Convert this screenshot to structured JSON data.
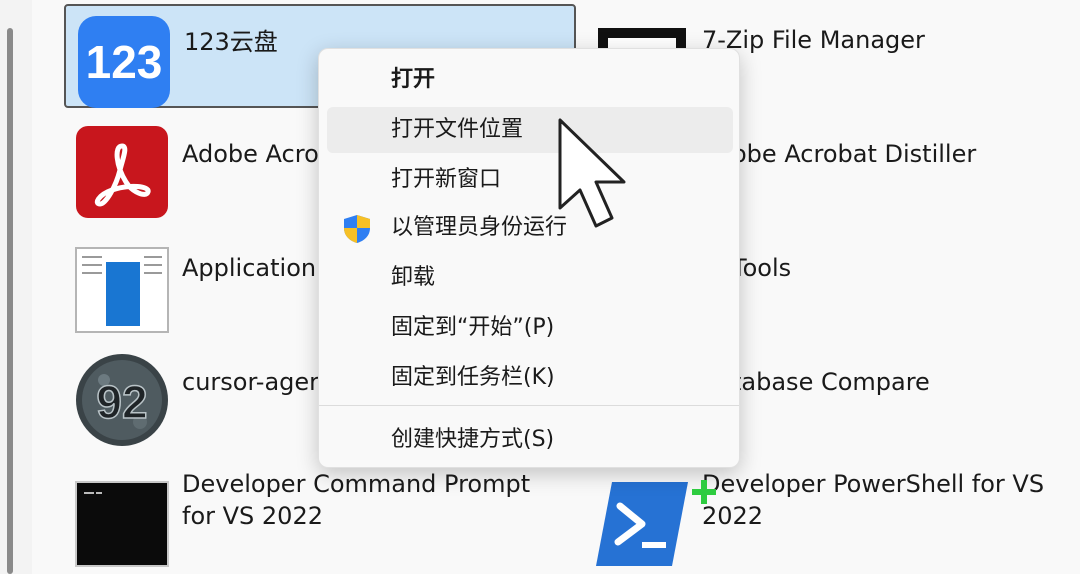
{
  "apps": [
    {
      "name": "123云盘"
    },
    {
      "name": "7-Zip File Manager"
    },
    {
      "name": "Adobe Acro"
    },
    {
      "name": "obe Acrobat Distiller"
    },
    {
      "name": "Application"
    },
    {
      "name": " Tools"
    },
    {
      "name": "cursor-ager"
    },
    {
      "name": "tabase Compare"
    },
    {
      "name": "Developer Command Prompt\nfor VS 2022"
    },
    {
      "name": "Developer PowerShell for VS\n2022"
    }
  ],
  "context_menu": {
    "items": [
      {
        "label": "打开",
        "bold": true
      },
      {
        "label": "打开文件位置",
        "hover": true
      },
      {
        "label": "打开新窗口"
      },
      {
        "label": "以管理员身份运行",
        "icon": "uac-shield-icon"
      },
      {
        "label": "卸载"
      },
      {
        "label": "固定到“开始”(P)"
      },
      {
        "label": "固定到任务栏(K)"
      },
      {
        "label": "创建快捷方式(S)"
      }
    ]
  },
  "icons": {
    "app_123": "cloud-drive-icon",
    "app_7zip": "archive-icon",
    "app_acrobat": "pdf-icon",
    "app_application": "window-icon",
    "app_cursor": "cursor-agent-icon",
    "app_devcmd": "terminal-icon",
    "app_devps": "powershell-icon",
    "pointer": "mouse-pointer-icon",
    "move": "move-crosshair-icon"
  },
  "colors": {
    "selection_bg": "#cce4f7",
    "brand_123": "#2f7ff2",
    "acrobat_red": "#c8161d",
    "powershell_blue": "#2672d4",
    "menu_hover": "#ececec"
  }
}
